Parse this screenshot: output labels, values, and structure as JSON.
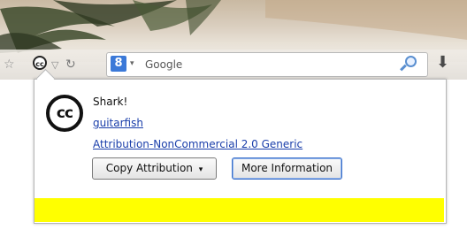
{
  "toolbar": {
    "search_placeholder": "Google",
    "search_engine_letter": "8"
  },
  "popup": {
    "title": "Shark!",
    "author": "guitarfish",
    "license": "Attribution-NonCommercial 2.0 Generic",
    "copy_button": "Copy Attribution",
    "copy_caret": "▾",
    "more_button": "More Information",
    "cc_label": "cc",
    "highlight_color": "#ffff00"
  }
}
